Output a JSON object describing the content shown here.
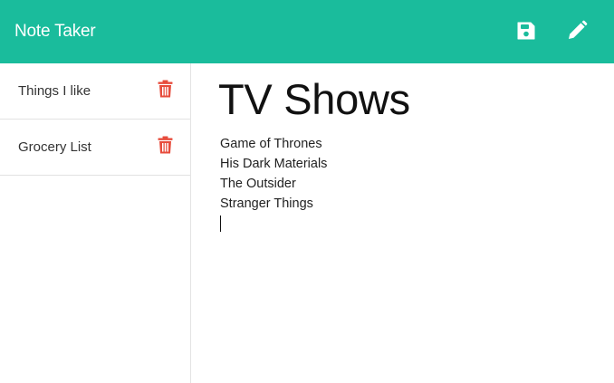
{
  "app": {
    "title": "Note Taker"
  },
  "toolbar": {
    "save_icon": "save-icon",
    "edit_icon": "pencil-icon"
  },
  "colors": {
    "navbar": "#1abc9c",
    "delete": "#e74c3c",
    "text": "#333333"
  },
  "notes": [
    {
      "title": "Things I like",
      "delete_icon": "trash-icon"
    },
    {
      "title": "Grocery List",
      "delete_icon": "trash-icon"
    }
  ],
  "active_note": {
    "title": "TV Shows",
    "lines": [
      "Game of Thrones",
      "His Dark Materials",
      "The Outsider",
      "Stranger Things"
    ]
  }
}
